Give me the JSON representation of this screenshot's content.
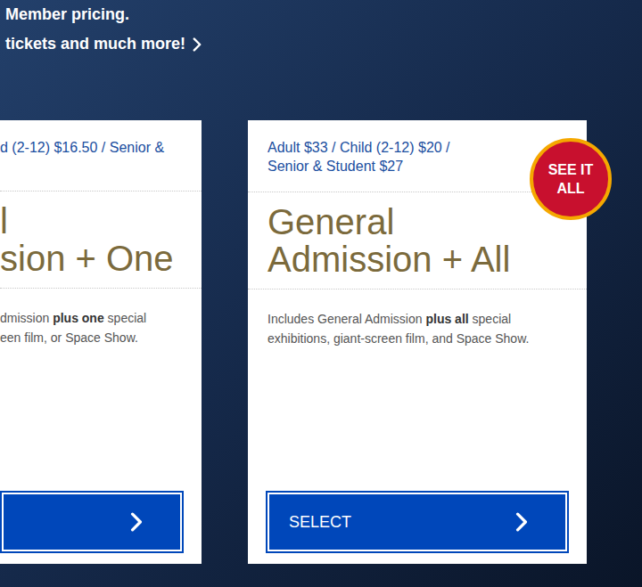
{
  "promo": {
    "lines": [
      "Member pricing.",
      "tickets and much more!"
    ]
  },
  "cards": [
    {
      "price": "d (2-12) $16.50 / Senior &",
      "title_lines": [
        "l",
        "sion + One"
      ],
      "description_lines": [
        [
          {
            "text": "dmission ",
            "bold": false
          },
          {
            "text": "plus one",
            "bold": true
          },
          {
            "text": " special",
            "bold": false
          }
        ],
        [
          {
            "text": "een film, or Space Show.",
            "bold": false
          }
        ]
      ],
      "button_label": "",
      "badge": ""
    },
    {
      "price": "Adult $33 / Child (2-12) $20 / Senior & Student $27",
      "title_lines": [
        "General",
        "Admission + All"
      ],
      "description_lines": [
        [
          {
            "text": "Includes General Admission ",
            "bold": false
          },
          {
            "text": "plus all",
            "bold": true
          },
          {
            "text": " special",
            "bold": false
          }
        ],
        [
          {
            "text": "exhibitions, giant-screen film, and Space Show.",
            "bold": false
          }
        ]
      ],
      "button_label": "SELECT",
      "badge": "SEE IT ALL"
    }
  ]
}
